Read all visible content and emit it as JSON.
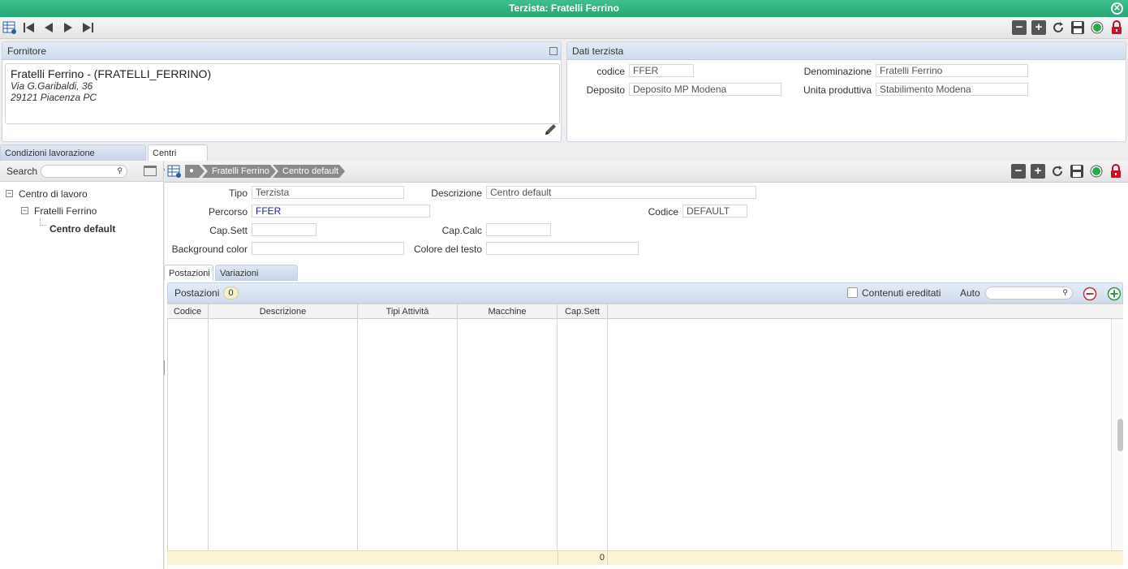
{
  "window": {
    "title": "Terzista: Fratelli Ferrino"
  },
  "fornitore": {
    "header": "Fornitore",
    "name": "Fratelli Ferrino  - (FRATELLI_FERRINO)",
    "address1": "Via G.Garibaldi, 36",
    "address2": "29121 Piacenza  PC"
  },
  "dati": {
    "header": "Dati terzista",
    "codice_label": "codice",
    "codice_value": "FFER",
    "denominazione_label": "Denominazione",
    "denominazione_value": "Fratelli Ferrino",
    "deposito_label": "Deposito",
    "deposito_value": "Deposito MP Modena",
    "unita_label": "Unita produttiva",
    "unita_value": "Stabilimento Modena"
  },
  "tabs": [
    "Condizioni lavorazione componenti",
    "Centri lavoro"
  ],
  "left": {
    "search_label": "Search",
    "tree": [
      "Centro di lavoro",
      "Fratelli Ferrino",
      "Centro default"
    ]
  },
  "breadcrumb": [
    "Fratelli Ferrino",
    "Centro default"
  ],
  "form": {
    "tipo_label": "Tipo",
    "tipo_value": "Terzista",
    "descrizione_label": "Descrizione",
    "descrizione_value": "Centro default",
    "percorso_label": "Percorso",
    "percorso_value": "FFER",
    "codice_label": "Codice",
    "codice_value": "DEFAULT",
    "capsett_label": "Cap.Sett",
    "capsett_value": "",
    "capcalc_label": "Cap.Calc",
    "capcalc_value": "",
    "bg_label": "Background color",
    "bg_value": "",
    "testo_label": "Colore del testo",
    "testo_value": ""
  },
  "subtabs": [
    "Postazioni",
    "Variazioni capacità"
  ],
  "grid": {
    "title": "Postazioni",
    "count": "0",
    "inherited_label": "Contenuti ereditati",
    "auto_label": "Auto",
    "columns": [
      "Codice",
      "Descrizione",
      "Tipi Attività",
      "Macchine",
      "Cap.Sett"
    ],
    "total": "0"
  },
  "colors": {
    "accent": "#27a673",
    "header_blue": "#cfdcee",
    "link": "#2222aa"
  }
}
